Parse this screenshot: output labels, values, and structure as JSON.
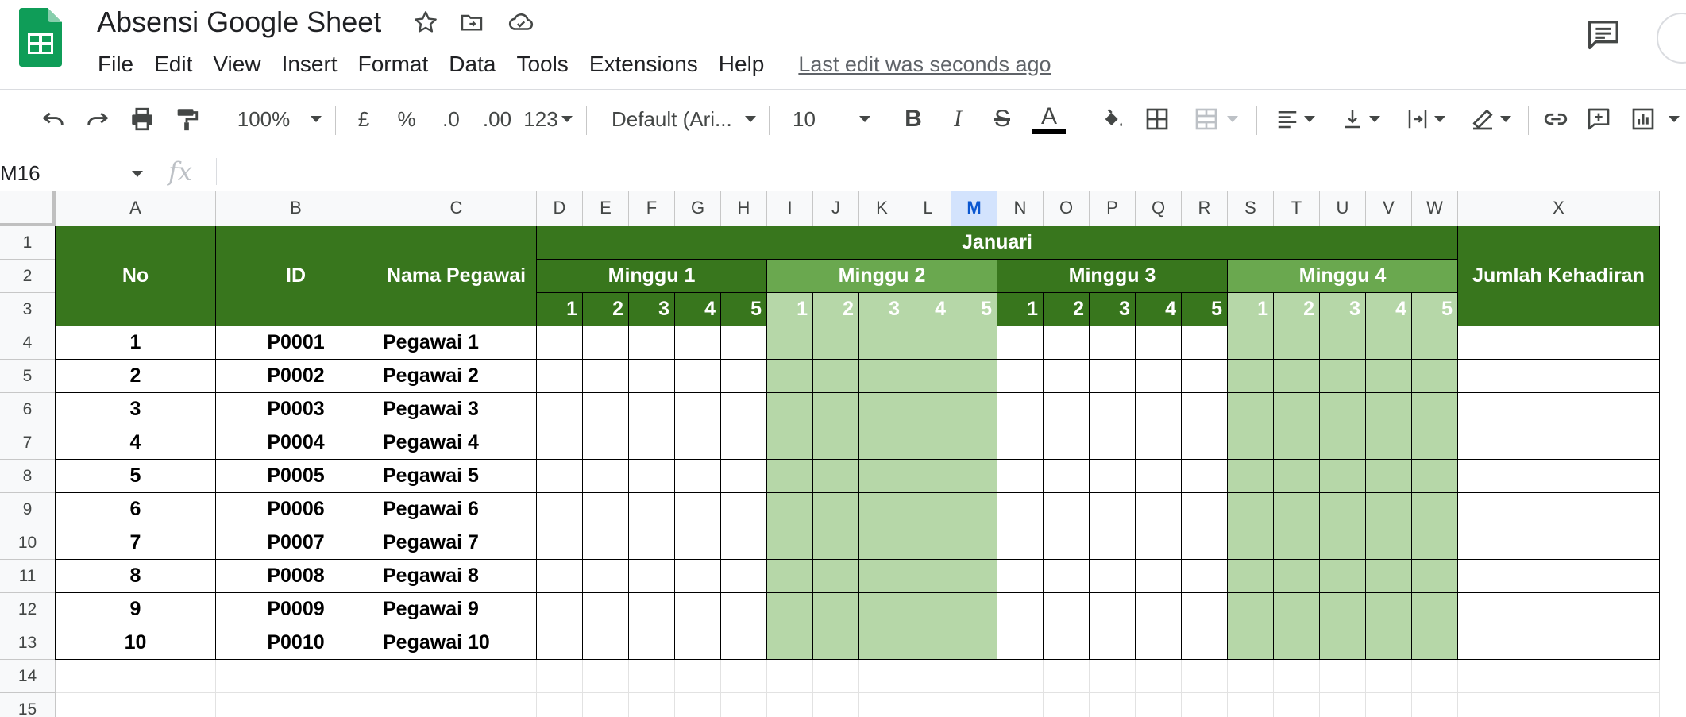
{
  "header": {
    "title": "Absensi Google Sheet",
    "menu": [
      "File",
      "Edit",
      "View",
      "Insert",
      "Format",
      "Data",
      "Tools",
      "Extensions",
      "Help"
    ],
    "last_edit": "Last edit was seconds ago"
  },
  "toolbar": {
    "zoom": "100%",
    "currency": "£",
    "percent": "%",
    "decrease_decimal": ".0",
    "increase_decimal": ".00",
    "more_formats": "123",
    "font": "Default (Ari...",
    "font_size": "10",
    "bold": "B",
    "italic": "I",
    "strikethrough": "S",
    "text_color": "A"
  },
  "formula_bar": {
    "cell_ref": "M16",
    "fx": "fx",
    "value": ""
  },
  "columns": [
    "A",
    "B",
    "C",
    "D",
    "E",
    "F",
    "G",
    "H",
    "I",
    "J",
    "K",
    "L",
    "M",
    "N",
    "O",
    "P",
    "Q",
    "R",
    "S",
    "T",
    "U",
    "V",
    "W",
    "X"
  ],
  "selected_column": "M",
  "row_numbers": [
    "1",
    "2",
    "3",
    "4",
    "5",
    "6",
    "7",
    "8",
    "9",
    "10",
    "11",
    "12",
    "13",
    "14",
    "15"
  ],
  "sheet": {
    "month": "Januari",
    "header_no": "No",
    "header_id": "ID",
    "header_name": "Nama Pegawai",
    "header_total": "Jumlah Kehadiran",
    "weeks": [
      "Minggu 1",
      "Minggu 2",
      "Minggu 3",
      "Minggu 4"
    ],
    "days": [
      "1",
      "2",
      "3",
      "4",
      "5"
    ],
    "employees": [
      {
        "no": "1",
        "id": "P0001",
        "name": "Pegawai 1"
      },
      {
        "no": "2",
        "id": "P0002",
        "name": "Pegawai 2"
      },
      {
        "no": "3",
        "id": "P0003",
        "name": "Pegawai 3"
      },
      {
        "no": "4",
        "id": "P0004",
        "name": "Pegawai 4"
      },
      {
        "no": "5",
        "id": "P0005",
        "name": "Pegawai 5"
      },
      {
        "no": "6",
        "id": "P0006",
        "name": "Pegawai 6"
      },
      {
        "no": "7",
        "id": "P0007",
        "name": "Pegawai 7"
      },
      {
        "no": "8",
        "id": "P0008",
        "name": "Pegawai 8"
      },
      {
        "no": "9",
        "id": "P0009",
        "name": "Pegawai 9"
      },
      {
        "no": "10",
        "id": "P0010",
        "name": "Pegawai 10"
      }
    ]
  },
  "colors": {
    "dark_green": "#38761d",
    "mid_green": "#6aa84f",
    "light_green": "#b6d7a8",
    "sheets_green": "#0f9d58"
  }
}
